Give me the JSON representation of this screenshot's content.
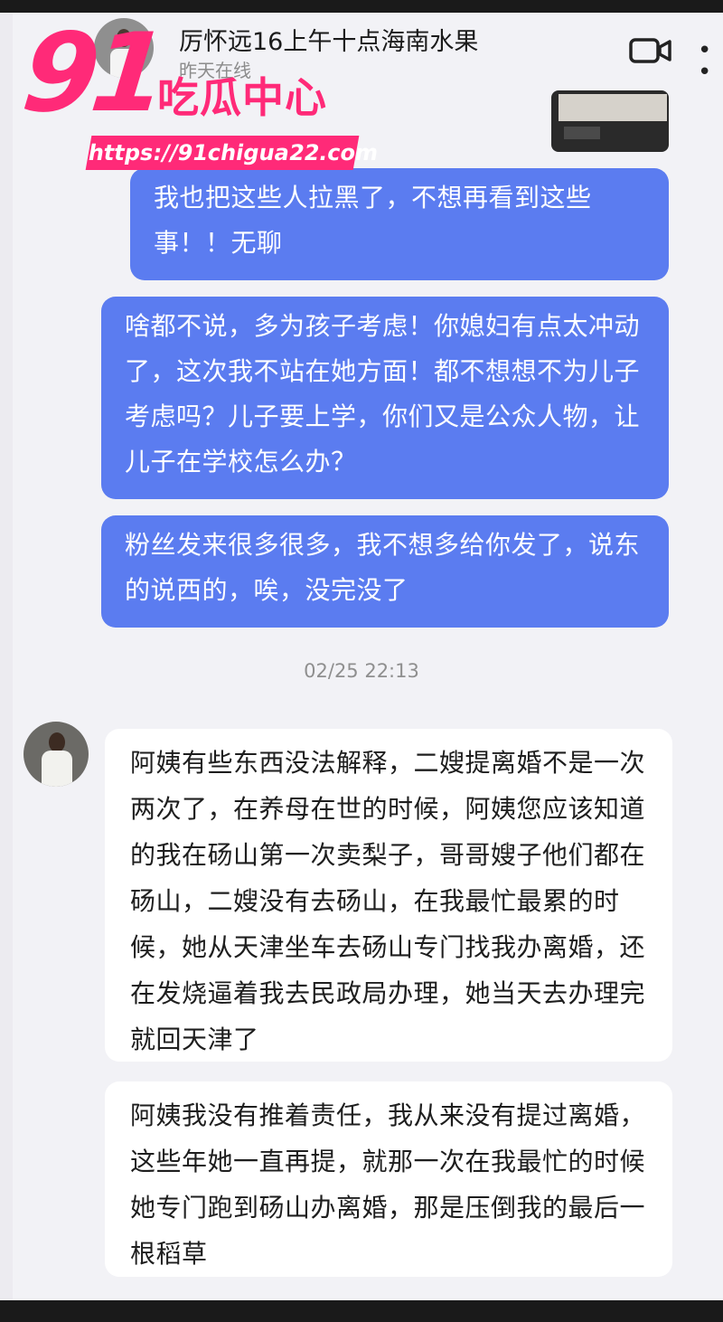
{
  "header": {
    "title": "厉怀远16上午十点海南水果",
    "status": "昨天在线"
  },
  "messages_sent": [
    "我也把这些人拉黑了，不想再看到这些事！！无聊",
    "啥都不说，多为孩子考虑！你媳妇有点太冲动了，这次我不站在她方面！都不想想不为儿子考虑吗？儿子要上学，你们又是公众人物，让儿子在学校怎么办？",
    "粉丝发来很多很多，我不想多给你发了，说东的说西的，唉，没完没了"
  ],
  "timestamp": "02/25 22:13",
  "messages_received": [
    "阿姨有些东西没法解释，二嫂提离婚不是一次两次了，在养母在世的时候，阿姨您应该知道的我在砀山第一次卖梨子，哥哥嫂子他们都在砀山，二嫂没有去砀山，在我最忙最累的时候，她从天津坐车去砀山专门找我办离婚，还在发烧逼着我去民政局办理，她当天去办理完就回天津了",
    "阿姨我没有推着责任，我从来没有提过离婚，这些年她一直再提，就那一次在我最忙的时候她专门跑到砀山办离婚，那是压倒我的最后一根稻草"
  ],
  "watermark": {
    "number": "91",
    "name": "吃瓜中心",
    "url": "https://91chigua22.com"
  },
  "colors": {
    "sent_bubble": "#5b7cf0",
    "received_bubble": "#ffffff",
    "watermark": "#ff2a78"
  },
  "icons": {
    "video": "video-camera-icon",
    "more": "more-options-icon"
  }
}
